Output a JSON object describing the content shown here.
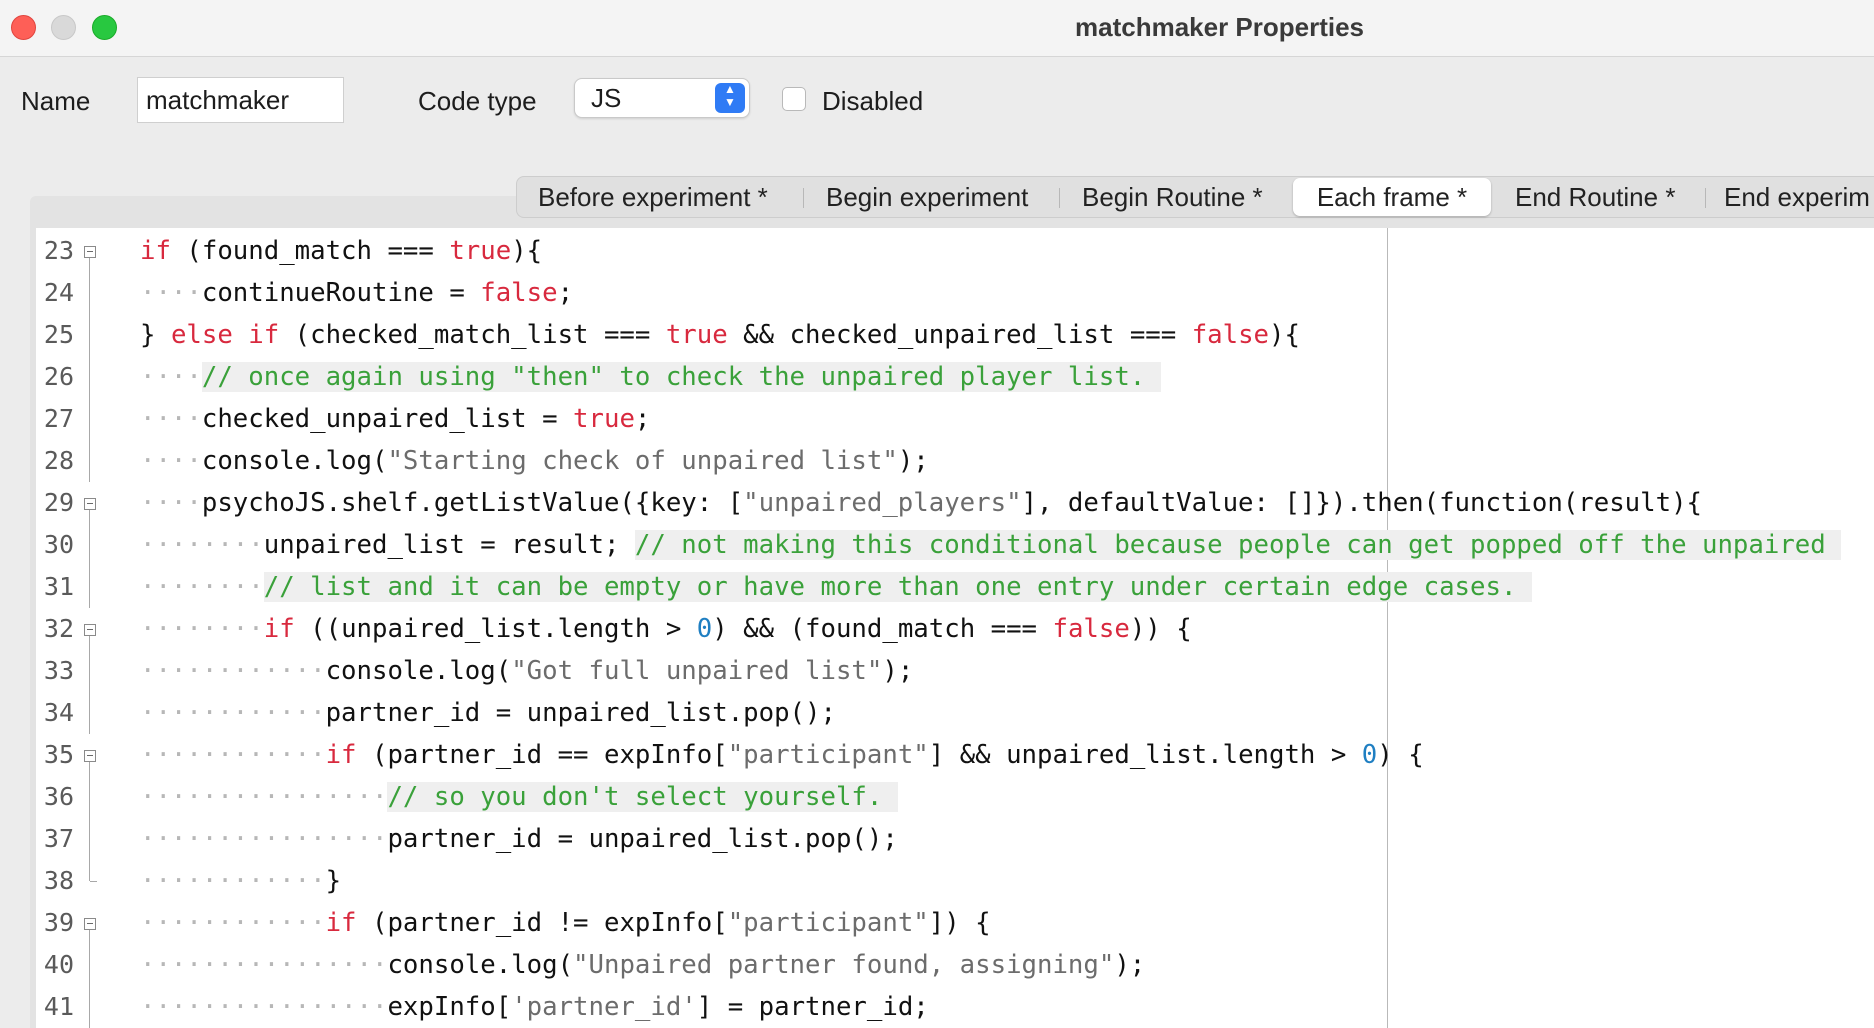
{
  "window": {
    "title": "matchmaker Properties"
  },
  "form": {
    "name_label": "Name",
    "name_value": "matchmaker",
    "code_type_label": "Code type",
    "code_type_value": "JS",
    "disabled_label": "Disabled",
    "disabled_checked": false
  },
  "tabs": [
    {
      "label": "Before experiment *",
      "active": false
    },
    {
      "label": "Begin experiment",
      "active": false
    },
    {
      "label": "Begin Routine *",
      "active": false
    },
    {
      "label": "Each frame *",
      "active": true
    },
    {
      "label": "End Routine *",
      "active": false
    },
    {
      "label": "End experim",
      "active": false
    }
  ],
  "editor": {
    "lines": [
      {
        "num": "23",
        "fold": "start",
        "tokens": [
          [
            "kw",
            "if"
          ],
          [
            "t",
            " (found_match === "
          ],
          [
            "kw",
            "true"
          ],
          [
            "t",
            "){"
          ]
        ]
      },
      {
        "num": "24",
        "tokens": [
          [
            "ws",
            "····"
          ],
          [
            "t",
            "continueRoutine = "
          ],
          [
            "kw",
            "false"
          ],
          [
            "t",
            ";"
          ]
        ]
      },
      {
        "num": "25",
        "tokens": [
          [
            "t",
            "} "
          ],
          [
            "kw",
            "else if"
          ],
          [
            "t",
            " (checked_match_list === "
          ],
          [
            "kw",
            "true"
          ],
          [
            "t",
            " && checked_unpaired_list === "
          ],
          [
            "kw",
            "false"
          ],
          [
            "t",
            "){"
          ]
        ]
      },
      {
        "num": "26",
        "tokens": [
          [
            "ws",
            "····"
          ],
          [
            "cmt",
            "// once again using \"then\" to check the unpaired player list. "
          ]
        ]
      },
      {
        "num": "27",
        "tokens": [
          [
            "ws",
            "····"
          ],
          [
            "t",
            "checked_unpaired_list = "
          ],
          [
            "kw",
            "true"
          ],
          [
            "t",
            ";"
          ]
        ]
      },
      {
        "num": "28",
        "tokens": [
          [
            "ws",
            "····"
          ],
          [
            "t",
            "console.log("
          ],
          [
            "str",
            "\"Starting check of unpaired list\""
          ],
          [
            "t",
            ");"
          ]
        ]
      },
      {
        "num": "29",
        "fold": "start",
        "tokens": [
          [
            "ws",
            "····"
          ],
          [
            "t",
            "psychoJS.shelf.getListValue({key: ["
          ],
          [
            "str",
            "\"unpaired_players\""
          ],
          [
            "t",
            "], defaultValue: []}).then(function(result){"
          ]
        ]
      },
      {
        "num": "30",
        "tokens": [
          [
            "ws",
            "········"
          ],
          [
            "t",
            "unpaired_list = result; "
          ],
          [
            "cmt",
            "// not making this conditional because people can get popped off the unpaired "
          ]
        ]
      },
      {
        "num": "31",
        "tokens": [
          [
            "ws",
            "········"
          ],
          [
            "cmt",
            "// list and it can be empty or have more than one entry under certain edge cases. "
          ]
        ]
      },
      {
        "num": "32",
        "fold": "start",
        "tokens": [
          [
            "ws",
            "········"
          ],
          [
            "kw",
            "if"
          ],
          [
            "t",
            " ((unpaired_list.length > "
          ],
          [
            "num",
            "0"
          ],
          [
            "t",
            ") && (found_match === "
          ],
          [
            "kw",
            "false"
          ],
          [
            "t",
            ")) {"
          ]
        ]
      },
      {
        "num": "33",
        "tokens": [
          [
            "ws",
            "············"
          ],
          [
            "t",
            "console.log("
          ],
          [
            "str",
            "\"Got full unpaired list\""
          ],
          [
            "t",
            ");"
          ]
        ]
      },
      {
        "num": "34",
        "tokens": [
          [
            "ws",
            "············"
          ],
          [
            "t",
            "partner_id = unpaired_list.pop();"
          ]
        ]
      },
      {
        "num": "35",
        "fold": "start",
        "tokens": [
          [
            "ws",
            "············"
          ],
          [
            "kw",
            "if"
          ],
          [
            "t",
            " (partner_id == expInfo["
          ],
          [
            "str",
            "\"participant\""
          ],
          [
            "t",
            "] && unpaired_list.length > "
          ],
          [
            "num",
            "0"
          ],
          [
            "t",
            ") {"
          ]
        ]
      },
      {
        "num": "36",
        "tokens": [
          [
            "ws",
            "················"
          ],
          [
            "cmt",
            "// so you don't select yourself. "
          ]
        ]
      },
      {
        "num": "37",
        "tokens": [
          [
            "ws",
            "················"
          ],
          [
            "t",
            "partner_id = unpaired_list.pop();"
          ]
        ]
      },
      {
        "num": "38",
        "fold": "end",
        "tokens": [
          [
            "ws",
            "············"
          ],
          [
            "t",
            "}"
          ]
        ]
      },
      {
        "num": "39",
        "fold": "start",
        "tokens": [
          [
            "ws",
            "············"
          ],
          [
            "kw",
            "if"
          ],
          [
            "t",
            " (partner_id != expInfo["
          ],
          [
            "str",
            "\"participant\""
          ],
          [
            "t",
            "]) {"
          ]
        ]
      },
      {
        "num": "40",
        "tokens": [
          [
            "ws",
            "················"
          ],
          [
            "t",
            "console.log("
          ],
          [
            "str",
            "\"Unpaired partner found, assigning\""
          ],
          [
            "t",
            ");"
          ]
        ]
      },
      {
        "num": "41",
        "tokens": [
          [
            "ws",
            "················"
          ],
          [
            "t",
            "expInfo["
          ],
          [
            "str",
            "'partner_id'"
          ],
          [
            "t",
            "] = partner_id;"
          ]
        ]
      }
    ]
  }
}
